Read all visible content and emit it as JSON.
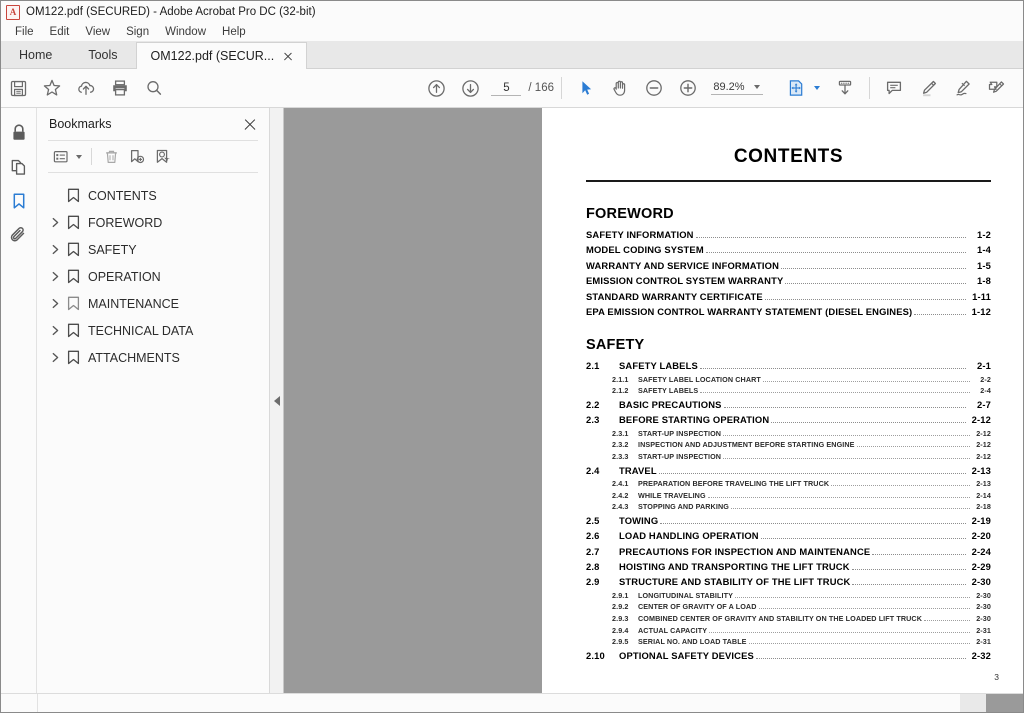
{
  "window": {
    "title": "OM122.pdf (SECURED) - Adobe Acrobat Pro DC (32-bit)",
    "app_icon": "pdf-document-icon",
    "icon_letter": "A"
  },
  "menu": {
    "items": [
      {
        "label": "File"
      },
      {
        "label": "Edit"
      },
      {
        "label": "View"
      },
      {
        "label": "Sign"
      },
      {
        "label": "Window"
      },
      {
        "label": "Help"
      }
    ]
  },
  "tabs": {
    "home": "Home",
    "tools": "Tools",
    "document": "OM122.pdf (SECUR...",
    "close_icon": "close-icon"
  },
  "toolbar": {
    "save_icon": "save-icon",
    "star_icon": "star-icon",
    "upload_icon": "cloud-upload-icon",
    "print_icon": "print-icon",
    "search_icon": "search-icon",
    "prev_page_icon": "arrow-up-circle-icon",
    "next_page_icon": "arrow-down-circle-icon",
    "page_current": "5",
    "page_total": "/ 166",
    "select_icon": "cursor-select-icon",
    "hand_icon": "hand-pan-icon",
    "zoom_out_icon": "zoom-out-icon",
    "zoom_in_icon": "zoom-in-icon",
    "zoom_value": "89.2%",
    "fit_page_icon": "fit-page-icon",
    "download_icon": "download-icon",
    "comment_icon": "comment-icon",
    "highlight_icon": "highlight-pen-icon",
    "sign_icon": "sign-pen-icon",
    "fill-and-sign_icon": "fill-and-sign-icon",
    "accent_color": "#2b7cd3"
  },
  "rail": {
    "items": [
      {
        "name": "security-lock-icon"
      },
      {
        "name": "page-thumbnails-icon"
      },
      {
        "name": "bookmarks-icon",
        "active": true
      },
      {
        "name": "attachments-icon"
      }
    ]
  },
  "panel": {
    "title": "Bookmarks",
    "close_icon": "close-icon",
    "tools": [
      {
        "name": "options-menu-icon"
      },
      {
        "name": "delete-bookmark-icon"
      },
      {
        "name": "new-bookmark-icon"
      },
      {
        "name": "find-bookmark-icon"
      }
    ],
    "bookmarks": [
      {
        "label": "CONTENTS",
        "expandable": false
      },
      {
        "label": "FOREWORD",
        "expandable": true
      },
      {
        "label": "SAFETY",
        "expandable": true
      },
      {
        "label": "OPERATION",
        "expandable": true
      },
      {
        "label": "MAINTENANCE",
        "expandable": true
      },
      {
        "label": "TECHNICAL DATA",
        "expandable": true
      },
      {
        "label": "ATTACHMENTS",
        "expandable": true
      }
    ]
  },
  "viewer": {
    "collapse_handle_icon": "chevron-left-icon",
    "background_color": "#9a9a9a"
  },
  "document": {
    "title": "CONTENTS",
    "folio": "3",
    "sections": [
      {
        "heading": "FOREWORD",
        "entries": [
          {
            "level": 1,
            "num": "",
            "text": "SAFETY INFORMATION",
            "page": "1-2"
          },
          {
            "level": 1,
            "num": "",
            "text": "MODEL CODING SYSTEM",
            "page": "1-4"
          },
          {
            "level": 1,
            "num": "",
            "text": "WARRANTY AND SERVICE INFORMATION",
            "page": "1-5"
          },
          {
            "level": 1,
            "num": "",
            "text": "EMISSION CONTROL SYSTEM WARRANTY",
            "page": "1-8"
          },
          {
            "level": 1,
            "num": "",
            "text": "STANDARD WARRANTY CERTIFICATE",
            "page": "1-11"
          },
          {
            "level": 1,
            "num": "",
            "text": "EPA EMISSION CONTROL WARRANTY STATEMENT (DIESEL ENGINES)",
            "page": "1-12"
          }
        ]
      },
      {
        "heading": "SAFETY",
        "entries": [
          {
            "level": 1,
            "num": "2.1",
            "text": "SAFETY LABELS",
            "page": "2-1"
          },
          {
            "level": 2,
            "num": "2.1.1",
            "text": "SAFETY LABEL LOCATION CHART",
            "page": "2-2"
          },
          {
            "level": 2,
            "num": "2.1.2",
            "text": "SAFETY LABELS",
            "page": "2-4"
          },
          {
            "level": 1,
            "num": "2.2",
            "text": "BASIC PRECAUTIONS",
            "page": "2-7"
          },
          {
            "level": 1,
            "num": "2.3",
            "text": "BEFORE STARTING OPERATION",
            "page": "2-12"
          },
          {
            "level": 2,
            "num": "2.3.1",
            "text": "START-UP INSPECTION",
            "page": "2-12"
          },
          {
            "level": 2,
            "num": "2.3.2",
            "text": "INSPECTION AND ADJUSTMENT BEFORE STARTING ENGINE",
            "page": "2-12"
          },
          {
            "level": 2,
            "num": "2.3.3",
            "text": "START-UP INSPECTION",
            "page": "2-12"
          },
          {
            "level": 1,
            "num": "2.4",
            "text": "TRAVEL",
            "page": "2-13"
          },
          {
            "level": 2,
            "num": "2.4.1",
            "text": "PREPARATION BEFORE TRAVELING THE LIFT TRUCK",
            "page": "2-13"
          },
          {
            "level": 2,
            "num": "2.4.2",
            "text": "WHILE TRAVELING",
            "page": "2-14"
          },
          {
            "level": 2,
            "num": "2.4.3",
            "text": "STOPPING AND PARKING",
            "page": "2-18"
          },
          {
            "level": 1,
            "num": "2.5",
            "text": "TOWING",
            "page": "2-19"
          },
          {
            "level": 1,
            "num": "2.6",
            "text": "LOAD HANDLING OPERATION",
            "page": "2-20"
          },
          {
            "level": 1,
            "num": "2.7",
            "text": "PRECAUTIONS FOR INSPECTION AND MAINTENANCE",
            "page": "2-24"
          },
          {
            "level": 1,
            "num": "2.8",
            "text": "HOISTING AND TRANSPORTING THE LIFT TRUCK",
            "page": "2-29"
          },
          {
            "level": 1,
            "num": "2.9",
            "text": "STRUCTURE AND STABILITY OF THE LIFT TRUCK",
            "page": "2-30"
          },
          {
            "level": 2,
            "num": "2.9.1",
            "text": "LONGITUDINAL STABILITY",
            "page": "2-30"
          },
          {
            "level": 2,
            "num": "2.9.2",
            "text": "CENTER OF GRAVITY OF A LOAD",
            "page": "2-30"
          },
          {
            "level": 2,
            "num": "2.9.3",
            "text": "COMBINED CENTER OF GRAVITY AND STABILITY ON THE LOADED LIFT TRUCK",
            "page": "2-30"
          },
          {
            "level": 2,
            "num": "2.9.4",
            "text": "ACTUAL CAPACITY",
            "page": "2-31"
          },
          {
            "level": 2,
            "num": "2.9.5",
            "text": "SERIAL NO. AND LOAD TABLE",
            "page": "2-31"
          },
          {
            "level": 1,
            "num": "2.10",
            "text": "OPTIONAL SAFETY DEVICES",
            "page": "2-32"
          }
        ]
      }
    ]
  }
}
